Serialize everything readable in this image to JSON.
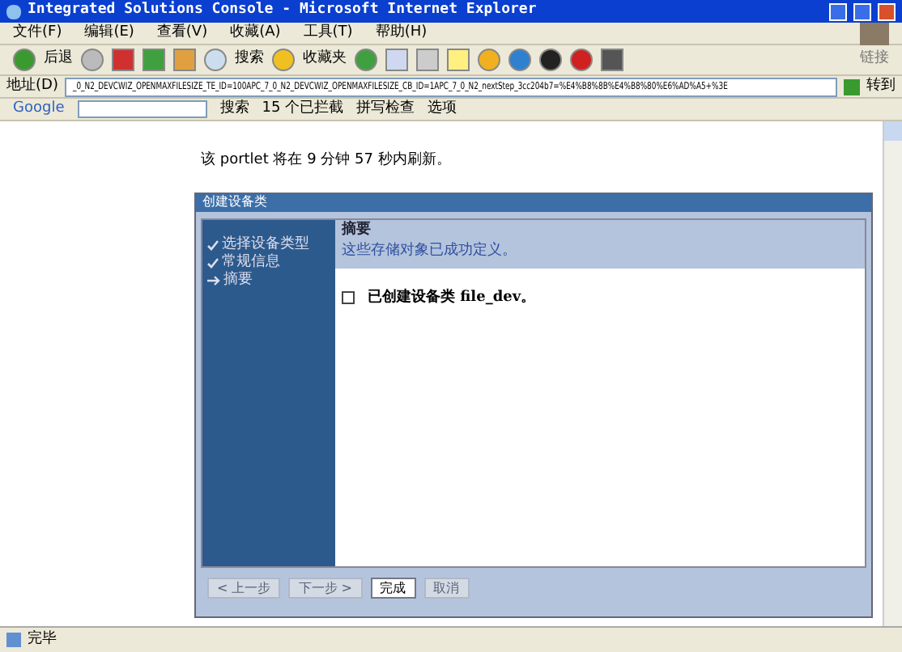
{
  "window": {
    "title": "Integrated Solutions Console - Microsoft Internet Explorer"
  },
  "menu": [
    "文件(F)",
    "编辑(E)",
    "查看(V)",
    "收藏(A)",
    "工具(T)",
    "帮助(H)"
  ],
  "toolbar": {
    "back": "后退",
    "search": "搜索",
    "favorites": "收藏夹",
    "links": "链接"
  },
  "address": {
    "label": "地址(D)",
    "value": "_0_N2_DEVCWIZ_OPENMAXFILESIZE_TE_ID=100APC_7_0_N2_DEVCWIZ_OPENMAXFILESIZE_CB_ID=1APC_7_0_N2_nextStep_3cc204b7=%E4%B8%8B%E4%B8%80%E6%AD%A5+%3E",
    "go": "转到"
  },
  "google": {
    "logo": "Google",
    "search": "搜索",
    "blocked": "15 个已拦截",
    "spell": "拼写检查",
    "options": "选项"
  },
  "refresh_notice": "该 portlet 将在 9 分钟 57 秒内刷新。",
  "portlet": {
    "title": "创建设备类",
    "steps": [
      {
        "label": "选择设备类型",
        "kind": "done"
      },
      {
        "label": "常规信息",
        "kind": "done"
      },
      {
        "label": "摘要",
        "kind": "current"
      }
    ],
    "heading": "摘要",
    "subtitle": "这些存储对象已成功定义。",
    "message": "已创建设备类 file_dev。",
    "buttons": [
      {
        "label": "< 上一步",
        "disabled": true
      },
      {
        "label": "下一步 >",
        "disabled": true
      },
      {
        "label": "完成",
        "disabled": false
      },
      {
        "label": "取消",
        "disabled": true
      }
    ]
  },
  "status_bar": "完毕"
}
